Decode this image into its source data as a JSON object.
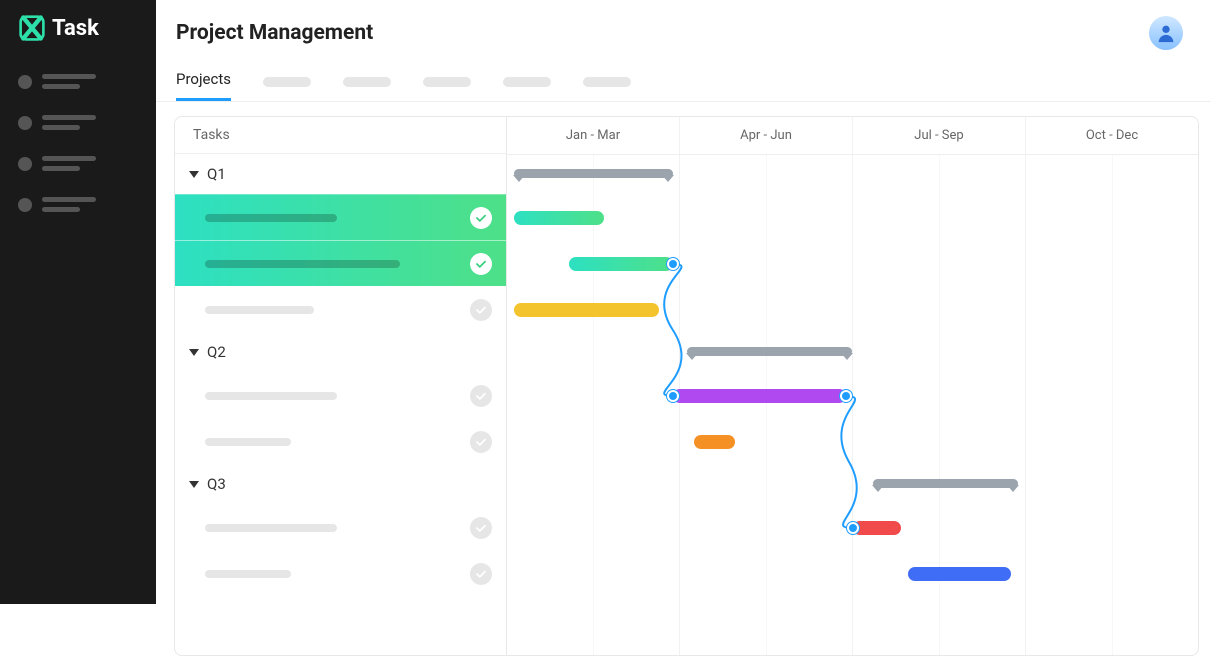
{
  "app": {
    "name": "Task"
  },
  "header": {
    "title": "Project Management"
  },
  "tabs": {
    "active": "Projects",
    "placeholders": 5
  },
  "taskColumn": {
    "header": "Tasks"
  },
  "timeline": {
    "quarters": [
      "Jan - Mar",
      "Apr - Jun",
      "Jul - Sep",
      "Oct - Dec"
    ]
  },
  "groups": [
    {
      "name": "Q1",
      "summaryBar": {
        "start": 1,
        "end": 24
      },
      "tasks": [
        {
          "done": true,
          "widthPct": 46,
          "highlighted": true,
          "bar": {
            "start": 1,
            "end": 14,
            "color": "teal-green"
          }
        },
        {
          "done": true,
          "widthPct": 68,
          "highlighted": true,
          "bar": {
            "start": 9,
            "end": 24,
            "color": "teal-green",
            "depEnd": true
          }
        },
        {
          "done": false,
          "widthPct": 38,
          "highlighted": false,
          "bar": {
            "start": 1,
            "end": 22,
            "color": "yellow"
          }
        }
      ]
    },
    {
      "name": "Q2",
      "summaryBar": {
        "start": 26,
        "end": 50
      },
      "tasks": [
        {
          "done": false,
          "widthPct": 46,
          "highlighted": false,
          "bar": {
            "start": 24,
            "end": 49,
            "color": "purple",
            "depStart": true,
            "depEnd": true
          }
        },
        {
          "done": false,
          "widthPct": 30,
          "highlighted": false,
          "bar": {
            "start": 27,
            "end": 33,
            "color": "orange"
          }
        }
      ]
    },
    {
      "name": "Q3",
      "summaryBar": {
        "start": 53,
        "end": 74
      },
      "tasks": [
        {
          "done": false,
          "widthPct": 46,
          "highlighted": false,
          "bar": {
            "start": 50,
            "end": 57,
            "color": "red",
            "depStart": true
          }
        },
        {
          "done": false,
          "widthPct": 30,
          "highlighted": false,
          "bar": {
            "start": 58,
            "end": 73,
            "color": "blue"
          }
        }
      ]
    }
  ],
  "colors": {
    "teal-green": "linear-gradient(90deg,#2de0c2,#4ee088)",
    "yellow": "#f3c42d",
    "purple": "#b049f0",
    "orange": "#f59124",
    "red": "#f04a4a",
    "blue": "#3f6df5",
    "summary": "#9ba3ad"
  }
}
